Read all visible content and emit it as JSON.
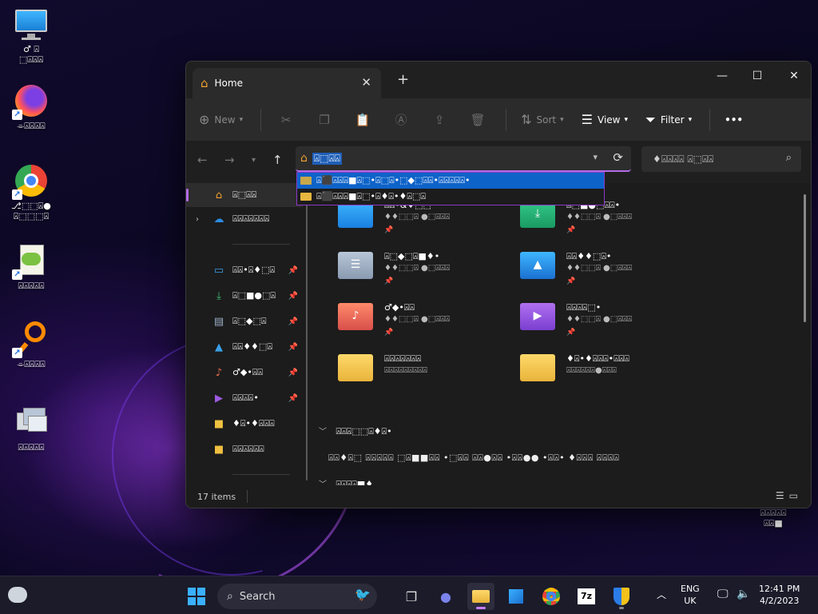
{
  "desktop": {
    "icons": [
      {
        "label": "♂ ⍓\n⬚⍓⍓⍓",
        "name": "this-pc"
      },
      {
        "label": "⌯⍓⍓⍓⍓",
        "name": "firefox"
      },
      {
        "label": "⎇⬚⬚⍓●\n⍓⬚⬚⬚⍓",
        "name": "chrome"
      },
      {
        "label": "⍓⍓⍓⍓⍓",
        "name": "notepad-plus"
      },
      {
        "label": "⌯⍓⍓⍓⍓",
        "name": "search-tool"
      },
      {
        "label": "⍓⍓⍓⍓⍓",
        "name": "remote-desktop"
      }
    ],
    "recycle_label": "⍓⍓⍓⍓⍓\n⍓⍓■"
  },
  "window": {
    "tab_title": "Home",
    "new_label": "New",
    "sort_label": "Sort",
    "view_label": "View",
    "filter_label": "Filter",
    "more_label": "•••",
    "address_text": "⍓⬚⍓⍓",
    "search_placeholder": "♦⍓⍓⍓⍓  ⍓⬚⍓⍓",
    "autocomplete": [
      "⍓⬛⍓⍓⍓■⍓⬚•⍓⬚⍓•⬚◆⬚⍓⍓•⍓⍓⍓⍓⍓•",
      "⍓⬛⍓⍓⍓■⍓⬚•⍓♦⍓•♦⍓⬚⍓"
    ],
    "nav": {
      "home": "⍓⬚⍓⍓",
      "onedrive": "⍓⍓⍓⍓⍓⍓⍓",
      "quick": [
        {
          "label": "⍓⍓•⍓♦⬚⍓",
          "icon": "desktop-icon"
        },
        {
          "label": "⍓⬚■●⬚⍓",
          "icon": "downloads-icon"
        },
        {
          "label": "⍓⬚◆⬚⍓",
          "icon": "documents-icon"
        },
        {
          "label": "⍓⍓♦♦⬚⍓",
          "icon": "pictures-icon"
        },
        {
          "label": "♂◆•⍓⍓",
          "icon": "music-icon"
        },
        {
          "label": "⍓⍓⍓⍓•",
          "icon": "videos-icon"
        },
        {
          "label": "♦⍓•♦⍓⍓⍓",
          "icon": "folder-icon"
        },
        {
          "label": "⍓⍓⍓⍓⍓⍓",
          "icon": "folder-icon"
        }
      ]
    },
    "tiles": [
      {
        "name": "⍓⍓•&♦⬚⬚",
        "sub": "♦♦⬚⬚⍓  ●⬚⍓⍓⍓",
        "pin": "📌"
      },
      {
        "name": "⍓⬚■●⬚⍓⍓•",
        "sub": "♦♦⬚⬚⍓  ●⬚⍓⍓⍓",
        "pin": "📌"
      },
      {
        "name": "⍓⬚◆⬚⍓■♦•",
        "sub": "♦♦⬚⬚⍓  ●⬚⍓⍓⍓",
        "pin": "📌"
      },
      {
        "name": "⍓⍓♦♦⬚⍓•",
        "sub": "♦♦⬚⬚⍓  ●⬚⍓⍓⍓",
        "pin": "📌"
      },
      {
        "name": "♂◆•⍓⍓",
        "sub": "♦♦⬚⬚⍓  ●⬚⍓⍓⍓",
        "pin": "📌"
      },
      {
        "name": "⍓⍓⍓⍓⬚•",
        "sub": "♦♦⬚⬚⍓  ●⬚⍓⍓⍓",
        "pin": "📌"
      },
      {
        "name": "⍓⍓⍓⍓⍓⍓⍓",
        "sub": "⍓⍓⍓⍓⍓⍓⍓⍓⍓",
        "pin": ""
      },
      {
        "name": "♦⍓•♦⍓⍓⍓•⍓⍓⍓",
        "sub": "⍓⍓⍓⍓⍓⍓●⍓⍓⍓",
        "pin": ""
      }
    ],
    "section_favorites": "⍓⍓⍓⬚⬚⍓♦⍓•",
    "favorites_hint": "⍓⍓♦⍓⬚  ⍓⍓⍓⍓⍓  ⬚⍓■■⍓⍓  •⬚⍓⍓  ⍓⍓●⍓⍓  •⍓⍓●●  •⍓⍓•  ♦⍓⍓⍓  ⍓⍓⍓⍓",
    "section_recent": "⍓⍓⍓⍓■♦",
    "status_items": "17 items"
  },
  "taskbar": {
    "search_label": "Search",
    "lang_1": "ENG",
    "lang_2": "UK",
    "time": "12:41 PM",
    "date": "4/2/2023"
  },
  "colors": {
    "accent": "#b36be8",
    "selection": "#1f5fb8",
    "window_bg": "#1c1c1c",
    "toolbar_bg": "#2b2b2b"
  }
}
